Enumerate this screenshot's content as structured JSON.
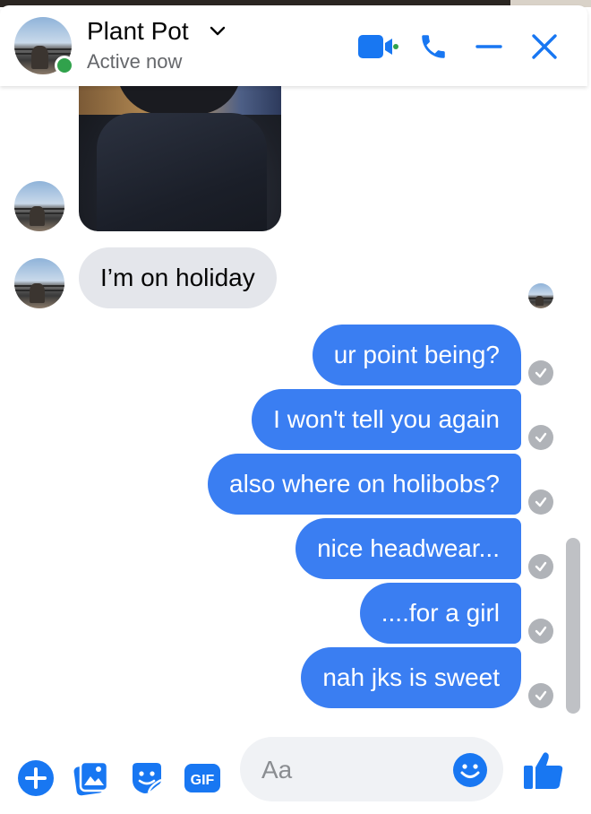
{
  "header": {
    "contact_name": "Plant Pot",
    "status": "Active now"
  },
  "messages": {
    "incoming": "I’m on holiday",
    "outgoing": [
      "ur point being?",
      "I won't tell you again",
      "also where on holibobs?",
      "nice headwear...",
      "....for a girl",
      "nah jks is sweet"
    ]
  },
  "composer": {
    "placeholder": "Aa",
    "gif_label": "GIF"
  },
  "colors": {
    "accent": "#3a7ef2",
    "icon_blue": "#1877f2",
    "online": "#31a24c",
    "incoming_bubble": "#e4e6eb",
    "seen_tick": "#b0b3b8"
  },
  "icons": {
    "header": [
      "video-call-icon",
      "phone-icon",
      "minimize-icon",
      "close-icon"
    ],
    "footer": [
      "plus-icon",
      "photo-icon",
      "sticker-icon",
      "gif-icon",
      "emoji-icon",
      "thumbs-up-icon"
    ]
  }
}
